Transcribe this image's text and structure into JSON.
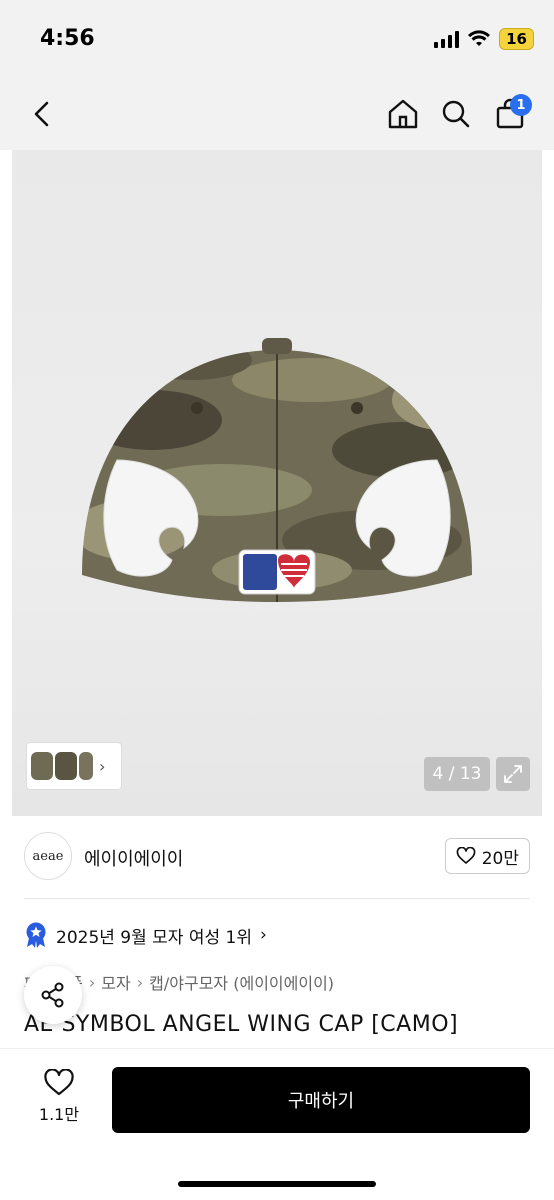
{
  "status_bar": {
    "time": "4:56",
    "battery": "16",
    "icons": [
      "cellular-signal-icon",
      "wifi-icon",
      "battery-icon"
    ]
  },
  "nav": {
    "icons": [
      "back-chevron-icon",
      "home-icon",
      "search-icon",
      "cart-icon"
    ],
    "cart_count": "1",
    "badge_color": "#2a6ff0"
  },
  "gallery": {
    "counter": "4 / 13",
    "thumb_arrow": "›",
    "icons": [
      "expand-icon",
      "chevron-right-icon"
    ]
  },
  "brand": {
    "logo_text": "aeae",
    "name": "에이이에이이",
    "likes": "20만",
    "like_icon": "heart-icon"
  },
  "ranking": {
    "text": "2025년 9월 모자 여성 1위",
    "chevron": "›",
    "badge_color": "#2a5ce0"
  },
  "breadcrumb": {
    "items": [
      "패션소품",
      "모자",
      "캡/야구모자 (에이이에이이)"
    ],
    "separator": "›"
  },
  "product": {
    "title": "AE SYMBOL ANGEL WING CAP [CAMO]"
  },
  "bottom_bar": {
    "wish_count": "1.1만",
    "buy_label": "구매하기",
    "buy_color": "#000000"
  }
}
